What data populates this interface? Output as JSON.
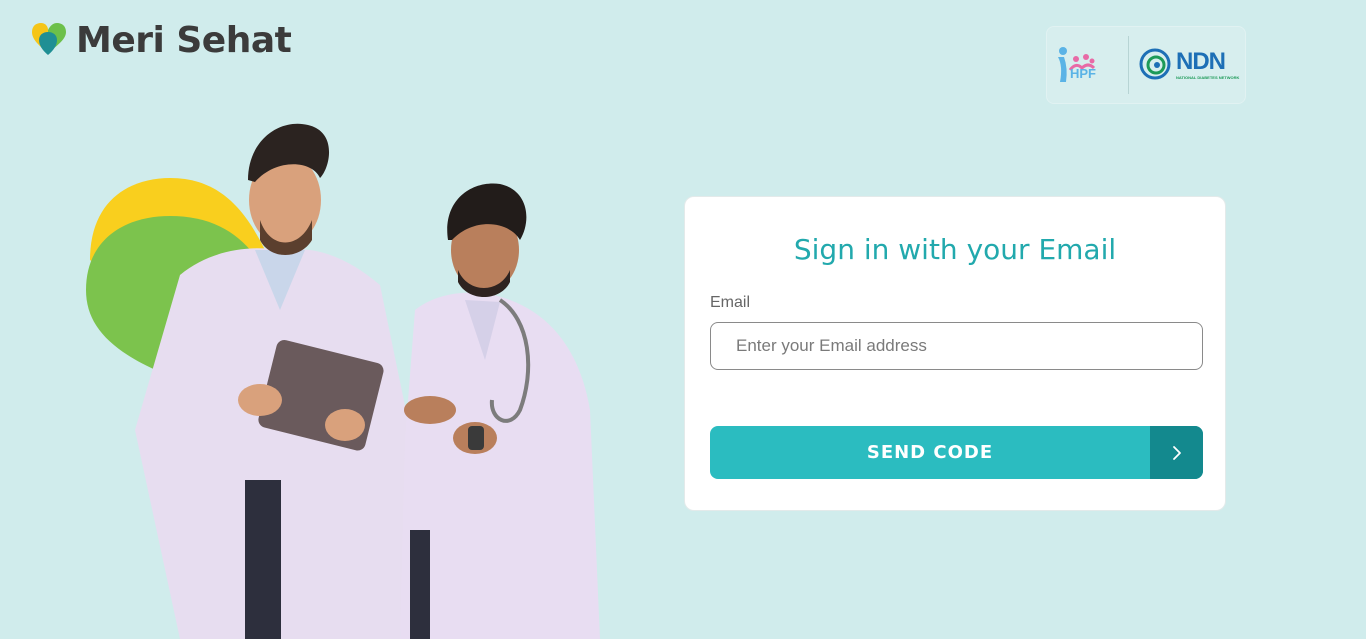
{
  "brand": {
    "name": "Meri Sehat"
  },
  "partners": {
    "hpf_label": "HPF",
    "ndn_label": "NDN",
    "ndn_subtitle": "NATIONAL DIABETES NETWORK"
  },
  "signin": {
    "title": "Sign in with your Email",
    "email_label": "Email",
    "email_placeholder": "Enter your Email address",
    "email_value": "",
    "send_button_label": "SEND CODE"
  },
  "icons": {
    "brand": "heart-logo-icon",
    "send": "chevron-right-icon"
  },
  "colors": {
    "background": "#d0ecec",
    "accent": "#2bbcc0",
    "accent_dark": "#13898e",
    "title": "#22a9ad",
    "brand_text": "#3b3b3b"
  }
}
